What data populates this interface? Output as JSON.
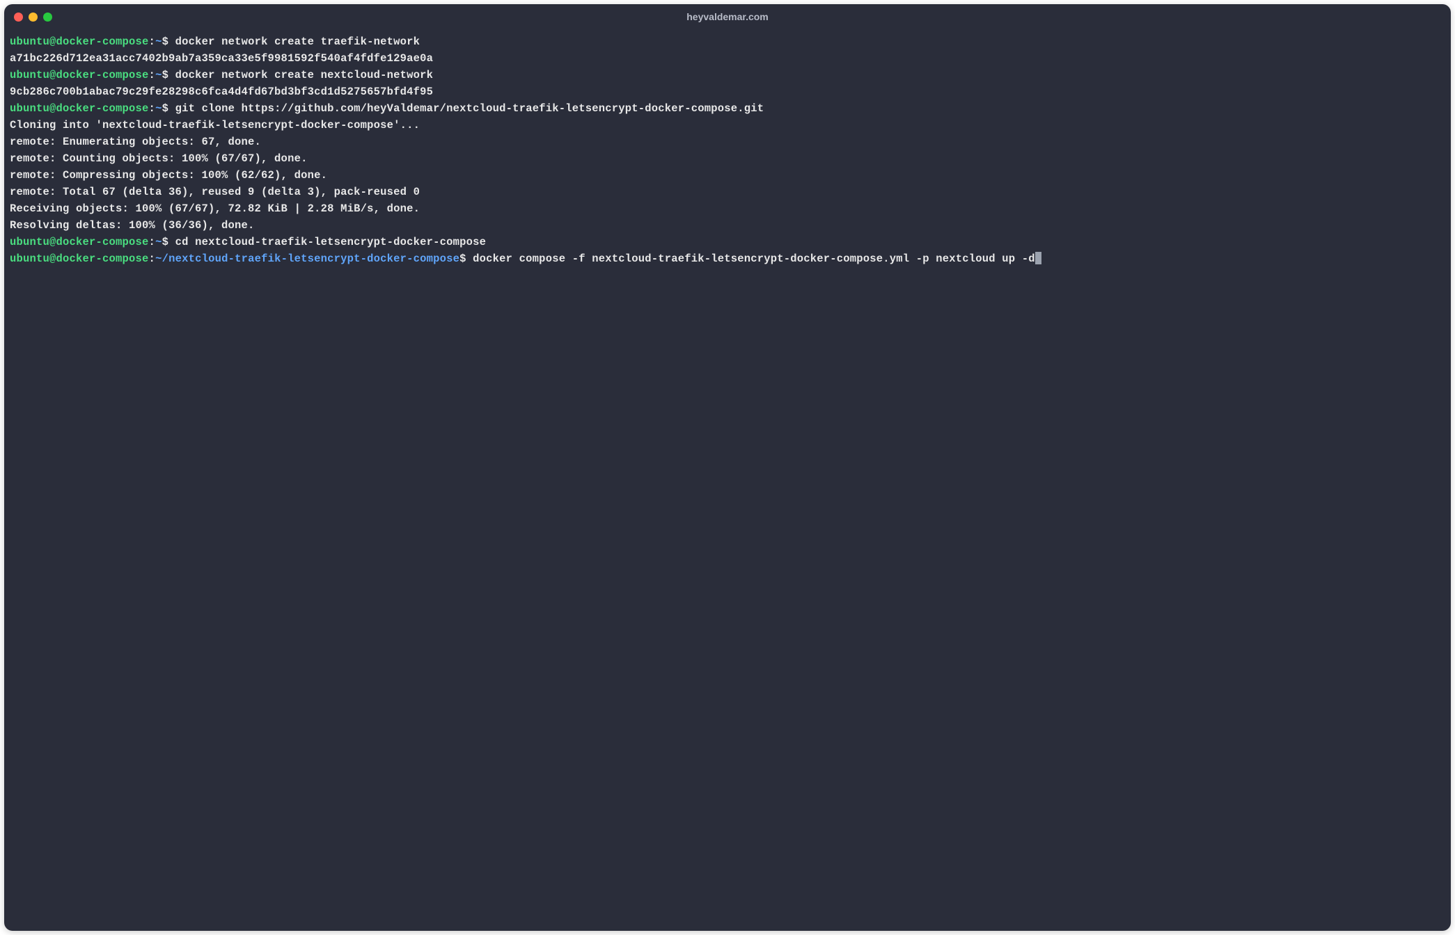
{
  "window": {
    "title": "heyvaldemar.com"
  },
  "prompt": {
    "user_host": "ubuntu@docker-compose",
    "sep": ":",
    "path_home": "~",
    "path_repo": "~/nextcloud-traefik-letsencrypt-docker-compose",
    "char": "$"
  },
  "lines": {
    "cmd1": "docker network create traefik-network",
    "out1": "a71bc226d712ea31acc7402b9ab7a359ca33e5f9981592f540af4fdfe129ae0a",
    "cmd2": "docker network create nextcloud-network",
    "out2": "9cb286c700b1abac79c29fe28298c6fca4d4fd67bd3bf3cd1d5275657bfd4f95",
    "cmd3": "git clone https://github.com/heyValdemar/nextcloud-traefik-letsencrypt-docker-compose.git",
    "out3a": "Cloning into 'nextcloud-traefik-letsencrypt-docker-compose'...",
    "out3b": "remote: Enumerating objects: 67, done.",
    "out3c": "remote: Counting objects: 100% (67/67), done.",
    "out3d": "remote: Compressing objects: 100% (62/62), done.",
    "out3e": "remote: Total 67 (delta 36), reused 9 (delta 3), pack-reused 0",
    "out3f": "Receiving objects: 100% (67/67), 72.82 KiB | 2.28 MiB/s, done.",
    "out3g": "Resolving deltas: 100% (36/36), done.",
    "cmd4": "cd nextcloud-traefik-letsencrypt-docker-compose",
    "cmd5": "docker compose -f nextcloud-traefik-letsencrypt-docker-compose.yml -p nextcloud up -d"
  }
}
